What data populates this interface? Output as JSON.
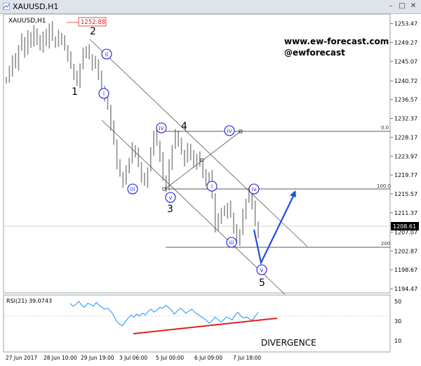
{
  "window": {
    "title": "XAUUSD,H1"
  },
  "chart": {
    "symbol_label": "XAUUSD,H1",
    "marker_price": "1252.88",
    "last_price": "1208.61",
    "watermark_url": "www.ew-forecast.com",
    "watermark_handle": "@ewforecast",
    "divergence_label": "DIVERGENCE",
    "rsi_label": "RSI(21) 39.0743",
    "fib_levels": [
      "0.0",
      "100.0",
      "200"
    ],
    "wave_labels_major": [
      "1",
      "2",
      "3",
      "4",
      "5"
    ],
    "wave_labels_minor": [
      "ii",
      "i",
      "iii",
      "iv",
      "v",
      "iv",
      "i",
      "iii",
      "iv",
      "v"
    ],
    "colors": {
      "candles": "#9a9a9a",
      "wave_circles": "#1f1fd8",
      "projection": "#1f4fe0",
      "divergence": "#e02020",
      "price_tag": "#e02020",
      "rsi_line": "#1e90ff"
    }
  },
  "chart_data": {
    "type": "line",
    "title": "XAUUSD,H1",
    "y_ticks": [
      "1253.47",
      "1249.27",
      "1245.07",
      "1240.72",
      "1236.57",
      "1232.37",
      "1228.17",
      "1223.97",
      "1219.77",
      "1215.57",
      "1211.37",
      "1207.07",
      "1202.87",
      "1198.67",
      "1194.47"
    ],
    "x_ticks": [
      "27 Jun 2017",
      "28 Jun 10:00",
      "29 Jun 19:00",
      "3 Jul 06:00",
      "5 Jul 00:00",
      "6 Jul 09:00",
      "7 Jul 18:00"
    ],
    "ylim": [
      1194.0,
      1254.5
    ],
    "series": [
      {
        "values": [
          1241,
          1243,
          1246,
          1244,
          1248,
          1250,
          1247,
          1251,
          1249,
          1252,
          1250,
          1248,
          1251,
          1249,
          1253,
          1250,
          1249,
          1251,
          1250,
          1248,
          1246,
          1244,
          1242,
          1240,
          1244,
          1247,
          1248,
          1246,
          1244,
          1245,
          1242,
          1239,
          1237,
          1235,
          1231,
          1227,
          1222,
          1220,
          1218,
          1221,
          1223,
          1226,
          1225,
          1222,
          1219,
          1218,
          1221,
          1225,
          1229,
          1227,
          1224,
          1219,
          1217,
          1222,
          1226,
          1229,
          1227,
          1225,
          1223,
          1226,
          1224,
          1222,
          1224,
          1222,
          1220,
          1218,
          1220,
          1215,
          1208,
          1210,
          1212,
          1211,
          1213,
          1211,
          1208,
          1205,
          1207,
          1211,
          1214,
          1216,
          1213,
          1209,
          1207
        ]
      }
    ],
    "annotations": {
      "fib": [
        {
          "label": "0.0",
          "price": 1228.8
        },
        {
          "label": "100.0",
          "price": 1216.2
        },
        {
          "label": "200",
          "price": 1204.0
        }
      ],
      "projection": [
        {
          "price": 1208.5
        },
        {
          "price": 1201.0
        },
        {
          "price": 1215.6
        }
      ]
    },
    "rsi": {
      "label": "RSI(21) 39.0743",
      "ticks": [
        "50",
        "30",
        "10"
      ],
      "ylim": [
        0,
        55
      ],
      "values": [
        48,
        45,
        47,
        50,
        46,
        44,
        48,
        47,
        45,
        49,
        46,
        44,
        42,
        43,
        40,
        36,
        30,
        27,
        25,
        29,
        33,
        36,
        34,
        37,
        35,
        38,
        36,
        40,
        42,
        39,
        41,
        44,
        43,
        46,
        44,
        41,
        37,
        40,
        43,
        41,
        38,
        40,
        42,
        39,
        37,
        35,
        33,
        31,
        28,
        30,
        34,
        32,
        29,
        31,
        34,
        33,
        31,
        36,
        39,
        35,
        33,
        34,
        32,
        31,
        35,
        39
      ]
    }
  }
}
